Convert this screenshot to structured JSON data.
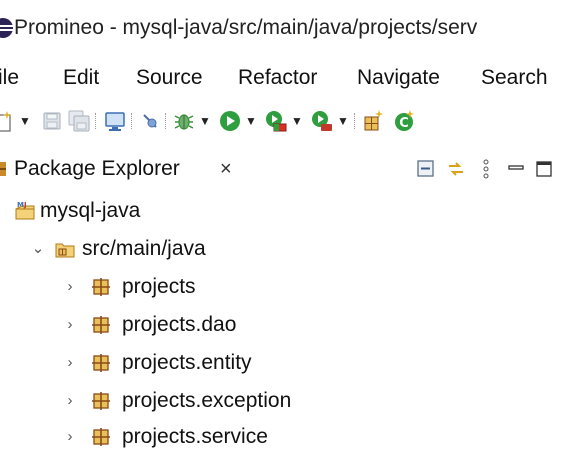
{
  "window": {
    "title": "Promineo - mysql-java/src/main/java/projects/serv"
  },
  "menubar": {
    "items": [
      "ile",
      "Edit",
      "Source",
      "Refactor",
      "Navigate",
      "Search"
    ]
  },
  "toolbar": {
    "icons": [
      "new-wizard-icon",
      "save-icon",
      "save-all-icon",
      "terminal-icon",
      "skip-breakpoints-icon",
      "debug-icon",
      "run-icon",
      "coverage-icon",
      "run-external-tool-icon",
      "new-java-package-icon",
      "new-java-class-icon"
    ]
  },
  "package_explorer": {
    "title": "Package Explorer",
    "close_glyph": "×",
    "header_icons": [
      "collapse-all-icon",
      "link-with-editor-icon",
      "view-menu-icon",
      "minimize-icon",
      "maximize-icon"
    ],
    "tree": {
      "project": {
        "label": "mysql-java",
        "icon": "maven-java-project-icon"
      },
      "source_folder": {
        "label": "src/main/java",
        "expanded": true,
        "icon": "source-folder-icon"
      },
      "packages": [
        {
          "label": "projects",
          "expanded": false,
          "icon": "package-icon"
        },
        {
          "label": "projects.dao",
          "expanded": false,
          "icon": "package-icon"
        },
        {
          "label": "projects.entity",
          "expanded": false,
          "icon": "package-icon"
        },
        {
          "label": "projects.exception",
          "expanded": false,
          "icon": "package-icon"
        },
        {
          "label": "projects.service",
          "expanded": false,
          "icon": "package-icon"
        }
      ]
    }
  },
  "colors": {
    "package_icon": "#8a4b16",
    "source_folder_icon": "#d9a11c",
    "run_green": "#2e9e3e",
    "debug_green": "#3a8f3a",
    "accent_blue": "#3c6eb4"
  }
}
